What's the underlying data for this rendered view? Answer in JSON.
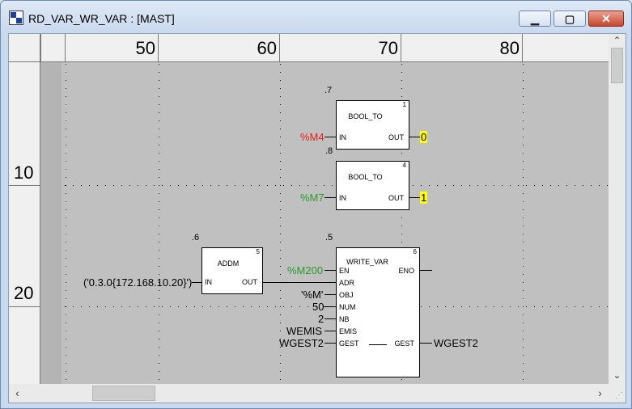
{
  "window": {
    "title": "RD_VAR_WR_VAR : [MAST]",
    "buttons": {
      "minimize": "▁",
      "maximize": "▢",
      "close": "✕"
    }
  },
  "columns": {
    "labels": [
      "50",
      "60",
      "70",
      "80"
    ]
  },
  "rows": {
    "labels": [
      "10",
      "20"
    ]
  },
  "scroll": {
    "up": "⌃",
    "down": "⌄",
    "left": "‹",
    "right": "›",
    "grip": "⋰"
  },
  "diagram": {
    "blocks": [
      {
        "exec": ".7",
        "num": "1",
        "name": "BOOL_TO",
        "pin_in": "IN",
        "pin_out": "OUT",
        "input": "%M4",
        "output": "0"
      },
      {
        "exec": ".8",
        "num": "4",
        "name": "BOOL_TO",
        "pin_in": "IN",
        "pin_out": "OUT",
        "input": "%M7",
        "output": "1"
      },
      {
        "exec": ".6",
        "num": "5",
        "name": "ADDM",
        "pin_in": "IN",
        "pin_out": "OUT",
        "input": "('0.3.0{172.168.10.20}')"
      },
      {
        "exec": ".5",
        "num": "6",
        "name": "WRITE_VAR",
        "pins_in": [
          "EN",
          "ADR",
          "OBJ",
          "NUM",
          "NB",
          "EMIS",
          "GEST"
        ],
        "pins_out": [
          "ENO",
          "GEST"
        ],
        "inputs": {
          "EN": "%M200",
          "OBJ": "'%M'",
          "NUM": "50",
          "NB": "2",
          "EMIS": "WEMIS",
          "GEST": "WGEST2"
        },
        "outputs": {
          "GEST": "WGEST2"
        }
      }
    ],
    "colors": {
      "false_var": "#e81c1c",
      "true_var": "#2a9a2a",
      "output_highlight": "#ffff00",
      "canvas": "#c0c0c0"
    }
  }
}
